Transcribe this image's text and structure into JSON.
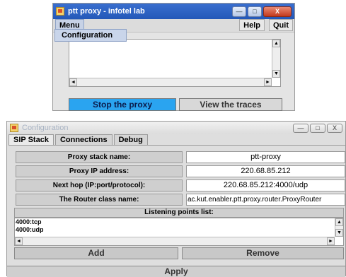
{
  "proxy_window": {
    "title": "ptt proxy - infotel lab",
    "buttons": {
      "minimize": "—",
      "maximize": "□",
      "close": "X"
    },
    "menu": {
      "menu_label": "Menu",
      "help_label": "Help",
      "quit_label": "Quit"
    },
    "dropdown": {
      "configuration_item": "Configuration"
    },
    "actions": {
      "stop_label": "Stop the proxy",
      "traces_label": "View the traces"
    },
    "icons": {
      "app": "app-icon",
      "scroll_up": "▲",
      "scroll_down": "▼",
      "scroll_left": "◄",
      "scroll_right": "►"
    }
  },
  "config_window": {
    "title": "Configuration",
    "buttons": {
      "minimize": "—",
      "maximize": "□",
      "close": "X"
    },
    "tabs": [
      {
        "label": "SIP Stack",
        "active": true
      },
      {
        "label": "Connections",
        "active": false
      },
      {
        "label": "Debug",
        "active": false
      }
    ],
    "sip_stack": {
      "rows": [
        {
          "label": "Proxy stack name:",
          "value": "ptt-proxy"
        },
        {
          "label": "Proxy IP address:",
          "value": "220.68.85.212"
        },
        {
          "label": "Next hop (IP:port/protocol):",
          "value": "220.68.85.212:4000/udp"
        },
        {
          "label": "The Router class name:",
          "value": "ac.kut.enabler.ptt.proxy.router.ProxyRouter"
        }
      ],
      "listening_points": {
        "header": "Listening points list:",
        "items": [
          "4000:tcp",
          "4000:udp"
        ]
      },
      "add_label": "Add",
      "remove_label": "Remove"
    },
    "apply_label": "Apply"
  },
  "colors": {
    "titlebar_active": "#2458b8",
    "stop_button": "#2aa4f0",
    "window_bg": "#e4e4e4"
  }
}
